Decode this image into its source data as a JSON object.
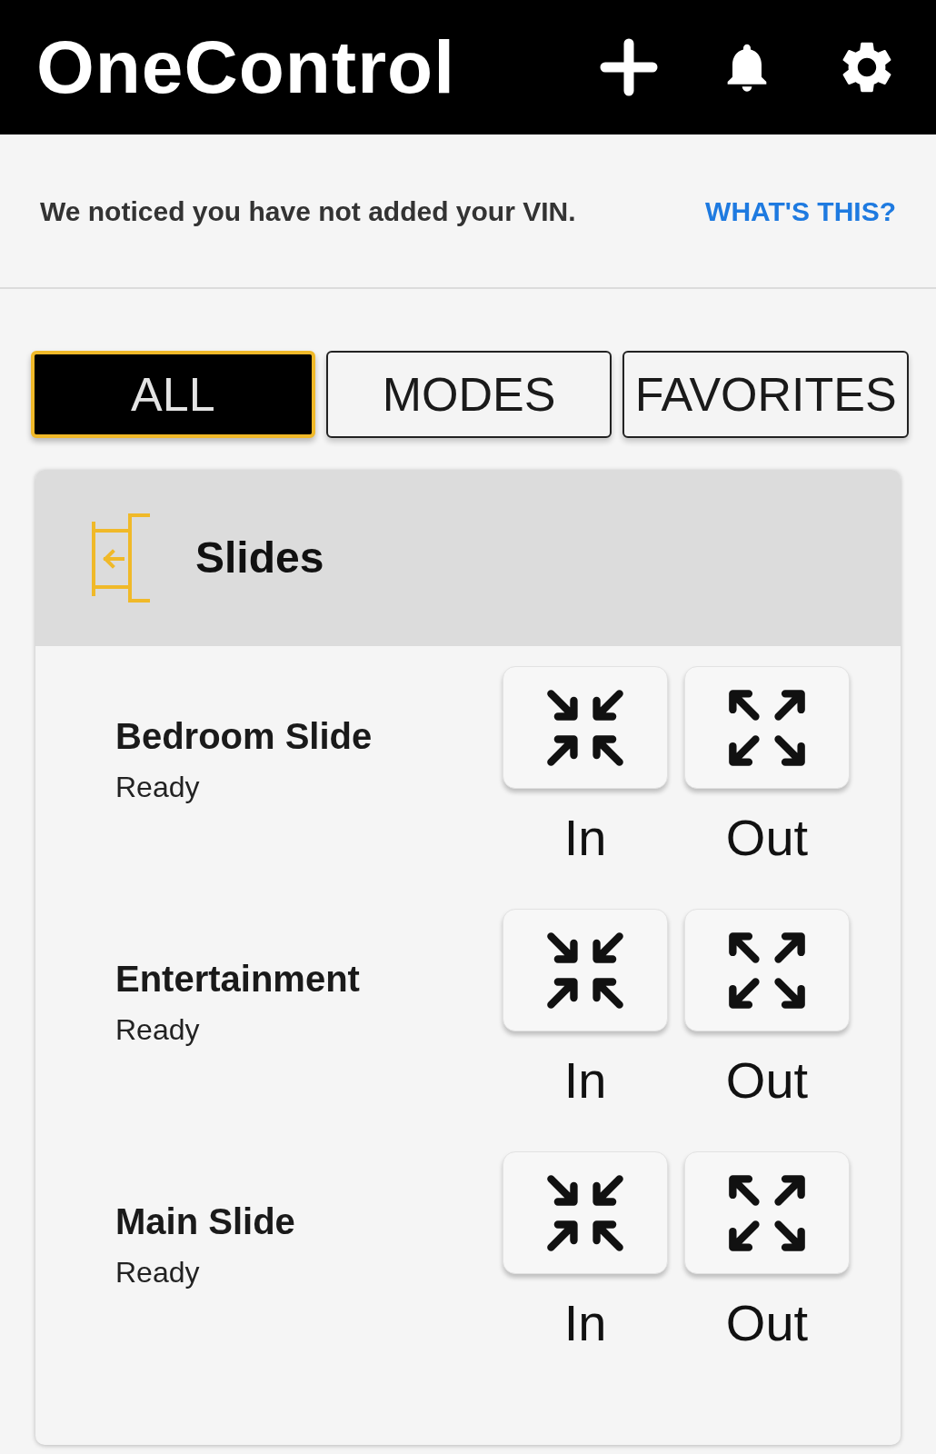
{
  "app_bar": {
    "title": "OneControl"
  },
  "vin_notice": {
    "message": "We noticed you have not added your VIN.",
    "link": "WHAT'S THIS?"
  },
  "tabs": [
    {
      "label": "ALL",
      "selected": true
    },
    {
      "label": "MODES",
      "selected": false
    },
    {
      "label": "FAVORITES",
      "selected": false
    }
  ],
  "group": {
    "title": "Slides",
    "devices": [
      {
        "name": "Bedroom Slide",
        "status": "Ready",
        "controls": [
          {
            "kind": "in",
            "label": "In"
          },
          {
            "kind": "out",
            "label": "Out"
          }
        ]
      },
      {
        "name": "Entertainment",
        "status": "Ready",
        "controls": [
          {
            "kind": "in",
            "label": "In"
          },
          {
            "kind": "out",
            "label": "Out"
          }
        ]
      },
      {
        "name": "Main Slide",
        "status": "Ready",
        "controls": [
          {
            "kind": "in",
            "label": "In"
          },
          {
            "kind": "out",
            "label": "Out"
          }
        ]
      }
    ]
  }
}
